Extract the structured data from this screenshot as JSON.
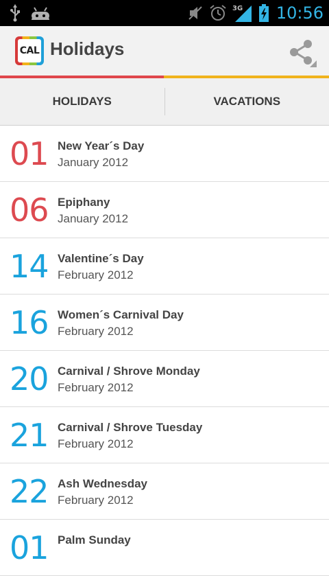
{
  "colors": {
    "accent_blue": "#33b5e5",
    "red_day": "#dd4a50",
    "blue_day": "#1aa3dd",
    "indicator_red": "#e0474c",
    "indicator_yellow": "#f0b31d"
  },
  "status_bar": {
    "time": "10:56",
    "network": "3G",
    "icons": [
      "usb-icon",
      "android-debug-icon",
      "mute-icon",
      "alarm-icon",
      "signal-icon",
      "battery-charging-icon"
    ]
  },
  "action_bar": {
    "app_icon_text": "CAL",
    "title": "Holidays",
    "share_icon": "share-icon"
  },
  "tabs": [
    {
      "label": "HOLIDAYS",
      "selected": true
    },
    {
      "label": "VACATIONS",
      "selected": false
    }
  ],
  "holidays": [
    {
      "day": "01",
      "name": "New Year´s Day",
      "month": "January 2012",
      "color": "red"
    },
    {
      "day": "06",
      "name": "Epiphany",
      "month": "January 2012",
      "color": "red"
    },
    {
      "day": "14",
      "name": "Valentine´s Day",
      "month": "February 2012",
      "color": "blue"
    },
    {
      "day": "16",
      "name": "Women´s Carnival Day",
      "month": "February 2012",
      "color": "blue"
    },
    {
      "day": "20",
      "name": "Carnival / Shrove Monday",
      "month": "February 2012",
      "color": "blue"
    },
    {
      "day": "21",
      "name": "Carnival / Shrove Tuesday",
      "month": "February 2012",
      "color": "blue"
    },
    {
      "day": "22",
      "name": "Ash Wednesday",
      "month": "February 2012",
      "color": "blue"
    },
    {
      "day": "01",
      "name": "Palm Sunday",
      "month": "",
      "color": "blue"
    }
  ]
}
